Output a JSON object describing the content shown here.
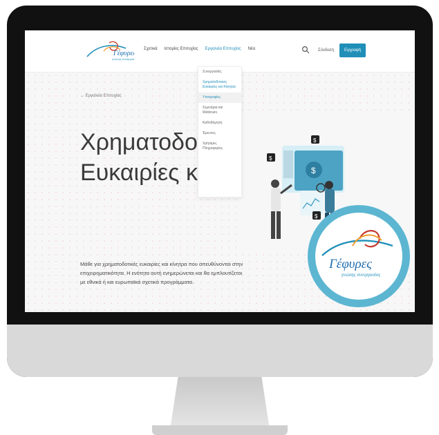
{
  "nav": {
    "items": [
      "Σχετικά",
      "Ιστορίες Επιτυχίας",
      "Εργαλεία Επιτυχίας",
      "Νέα"
    ],
    "login": "Σύνδεση",
    "register": "Εγγραφή"
  },
  "dropdown": {
    "items": [
      "Συνεργασίες",
      "Χρηματοδοτικές Ευκαιρίες και Κίνητρα",
      "Υποτροφίες",
      "Σεμινάρια και Webinars",
      "Καθοδήγηση",
      "Έρευνες",
      "Χρήσιμες Πληροφορίες"
    ]
  },
  "breadcrumb": "← Εργαλεία Επιτυχίας",
  "hero": {
    "line1": "Χρηματοδοτικές",
    "line2": "Ευκαιρίες και Κίν"
  },
  "description": "Μάθε για χρηματοδοτικές ευκαιρίες και κίνητρα που απευθύνονται στην επιχειρηματικότητα. Η ενότητα αυτή ενημερώνεται και θα εμπλουτίζεται με εθνικά ή και ευρωπαϊκά σχετικά προγράμματα.",
  "logo": {
    "main": "Γέφυρες",
    "sub": "γνώσης συνεργασίας"
  },
  "colors": {
    "accent": "#1f8fb8",
    "badge": "#5cb6d1",
    "logo_red": "#c53b2f"
  }
}
